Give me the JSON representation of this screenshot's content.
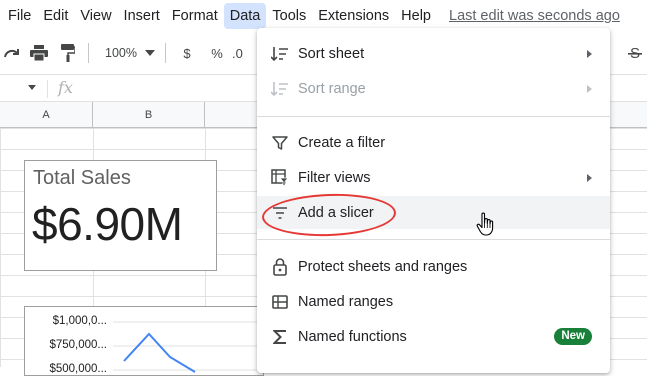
{
  "menubar": {
    "items": [
      "File",
      "Edit",
      "View",
      "Insert",
      "Format",
      "Data",
      "Tools",
      "Extensions",
      "Help"
    ],
    "active": "Data",
    "last_edit": "Last edit was seconds ago"
  },
  "toolbar": {
    "zoom": "100%",
    "currency": "$",
    "percent": "%",
    "decimal": ".0"
  },
  "formula_bar": {
    "fx": "fx"
  },
  "columns": [
    "A",
    "B"
  ],
  "scorecard": {
    "title": "Total Sales",
    "value": "$6.90M"
  },
  "chart_data": {
    "type": "line",
    "y_ticks": [
      "$1,000,0...",
      "$750,000...",
      "$500,000..."
    ],
    "series_color": "#4285f4",
    "title": "",
    "xlabel": "",
    "ylabel": ""
  },
  "dropdown": {
    "items": [
      {
        "label": "Sort sheet",
        "icon": "sort-icon",
        "submenu": true,
        "disabled": false
      },
      {
        "label": "Sort range",
        "icon": "sort-icon",
        "submenu": true,
        "disabled": true
      },
      {
        "label": "Create a filter",
        "icon": "filter-icon",
        "submenu": false,
        "disabled": false
      },
      {
        "label": "Filter views",
        "icon": "filter-views-icon",
        "submenu": true,
        "disabled": false
      },
      {
        "label": "Add a slicer",
        "icon": "slicer-icon",
        "submenu": false,
        "disabled": false,
        "hovered": true
      },
      {
        "label": "Protect sheets and ranges",
        "icon": "lock-icon",
        "submenu": false,
        "disabled": false
      },
      {
        "label": "Named ranges",
        "icon": "named-ranges-icon",
        "submenu": false,
        "disabled": false
      },
      {
        "label": "Named functions",
        "icon": "sigma-icon",
        "submenu": false,
        "disabled": false,
        "badge": "New"
      }
    ]
  },
  "colors": {
    "accent_active_menu": "#d3e3fd",
    "highlight_oval": "#e53935",
    "badge_green": "#188038"
  }
}
